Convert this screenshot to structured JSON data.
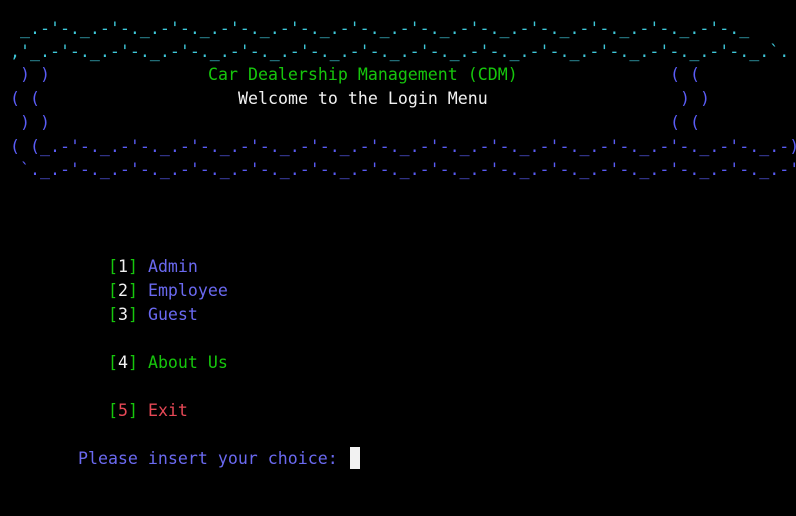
{
  "banner": {
    "top_border_1": "  _.-'-._.-'-._.-'-._.-'-._.-'-._.-'-._.-'-._.-'-._.-'-._.-'-._.-'-._.-'-._",
    "top_border_2": " ,'_.-'-._.-'-._.-'-._.-'-._.-'-._.-'-._.-'-._.-'-._.-'-._.-'-._.-'-._.-'-._.`. ( (",
    "side_left_1": " ) )",
    "side_right_1": "( (",
    "side_left_2": "( (",
    "side_right_2": ") )",
    "side_left_3": " ) )",
    "side_right_3": "( (",
    "bottom_border_1": "( (_.-'-._.-'-._.-'-._.-'-._.-'-._.-'-._.-'-._.-'-._.-'-._.-'-._.-'-._.-'-._.-) )",
    "bottom_border_2": "  `._.-'-._.-'-._.-'-._.-'-._.-'-._.-'-._.-'-._.-'-._.-'-._.-'-._.-'-._.-'-._.-'",
    "title": "Car Dealership Management (CDM)",
    "subtitle": "Welcome to the Login Menu"
  },
  "menu": {
    "items": [
      {
        "key": "1",
        "label": "Admin"
      },
      {
        "key": "2",
        "label": "Employee"
      },
      {
        "key": "3",
        "label": "Guest"
      },
      {
        "key": "4",
        "label": "About Us"
      },
      {
        "key": "5",
        "label": "Exit"
      }
    ]
  },
  "prompt": {
    "text": "Please insert your choice: "
  },
  "colors": {
    "border_cyan": "#3ec7d8",
    "border_blue": "#5a5cf5",
    "title_green": "#16c60c",
    "bracket_green": "#16c60c",
    "number_white": "#f2f2f2",
    "option_blue": "#6a69f0",
    "about_green": "#16c60c",
    "exit_red": "#e74856",
    "prompt_blue": "#6a69f0"
  }
}
